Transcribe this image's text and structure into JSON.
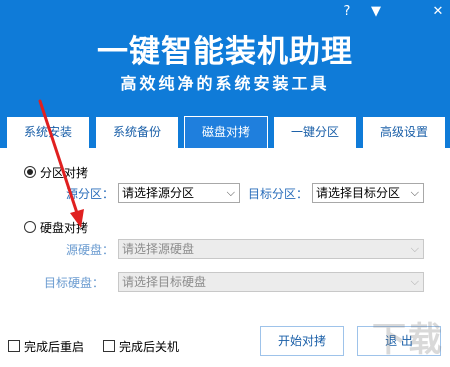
{
  "window": {
    "help_label": "?",
    "menu_label": "▼",
    "close_label": "✕"
  },
  "header": {
    "title": "一键智能装机助理",
    "subtitle": "高效纯净的系统安装工具"
  },
  "tabs": [
    {
      "label": "系统安装",
      "active": false
    },
    {
      "label": "系统备份",
      "active": false
    },
    {
      "label": "磁盘对拷",
      "active": true
    },
    {
      "label": "一键分区",
      "active": false
    },
    {
      "label": "高级设置",
      "active": false
    }
  ],
  "partition_copy": {
    "label": "分区对拷",
    "selected": true,
    "source_label": "源分区：",
    "source_value": "请选择源分区",
    "target_label": "目标分区：",
    "target_value": "请选择目标分区"
  },
  "disk_copy": {
    "label": "硬盘对拷",
    "selected": false,
    "source_label": "源硬盘：",
    "source_value": "请选择源硬盘",
    "target_label": "目标硬盘：",
    "target_value": "请选择目标硬盘"
  },
  "options": {
    "restart_label": "完成后重启",
    "restart_checked": false,
    "shutdown_label": "完成后关机",
    "shutdown_checked": false
  },
  "buttons": {
    "start_label": "开始对拷",
    "exit_label": "退 出"
  },
  "watermark": "下载",
  "colors": {
    "header_blue": "#0f7bd8",
    "active_tab": "#1f7fdd",
    "annotation_arrow": "#e02020"
  }
}
